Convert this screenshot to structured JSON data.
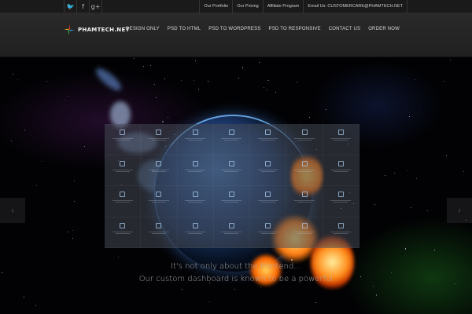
{
  "social": [
    {
      "icon": "twitter-icon",
      "glyph": "🐦"
    },
    {
      "icon": "facebook-icon",
      "glyph": "f"
    },
    {
      "icon": "google-plus-icon",
      "glyph": "g+"
    }
  ],
  "top_links": [
    "Our Portfolio",
    "Our Pricing",
    "Affiliate Program",
    "Email Us: CUSTOMERCARE@PHAMTECH.NET"
  ],
  "logo": {
    "text": "PHAMTECH.NET"
  },
  "nav": [
    "DESIGN ONLY",
    "PSD TO HTML",
    "PSD TO WORDPRESS",
    "PSD TO RESPONSIVE",
    "CONTACT US",
    "ORDER NOW"
  ],
  "dashboard": {
    "cells": [
      {
        "label": "",
        "icon": "box-icon"
      },
      {
        "label": "",
        "icon": "box-icon"
      },
      {
        "label": "",
        "icon": "box-icon"
      },
      {
        "label": "",
        "icon": "box-icon"
      },
      {
        "label": "",
        "icon": "box-icon"
      },
      {
        "label": "",
        "icon": "box-icon"
      },
      {
        "label": "",
        "icon": "box-icon"
      },
      {
        "label": "",
        "icon": "box-icon"
      },
      {
        "label": "",
        "icon": "box-icon"
      },
      {
        "label": "",
        "icon": "box-icon"
      },
      {
        "label": "",
        "icon": "box-icon"
      },
      {
        "label": "",
        "icon": "box-icon"
      },
      {
        "label": "",
        "icon": "box-icon"
      },
      {
        "label": "",
        "icon": "box-icon"
      },
      {
        "label": "",
        "icon": "box-icon"
      },
      {
        "label": "",
        "icon": "box-icon"
      },
      {
        "label": "",
        "icon": "box-icon"
      },
      {
        "label": "",
        "icon": "box-icon"
      },
      {
        "label": "",
        "icon": "box-icon"
      },
      {
        "label": "",
        "icon": "box-icon"
      },
      {
        "label": "",
        "icon": "box-icon"
      },
      {
        "label": "",
        "icon": "box-icon"
      },
      {
        "label": "",
        "icon": "box-icon"
      },
      {
        "label": "",
        "icon": "box-icon"
      },
      {
        "label": "",
        "icon": "box-icon"
      },
      {
        "label": "",
        "icon": "box-icon"
      },
      {
        "label": "",
        "icon": "box-icon"
      },
      {
        "label": "",
        "icon": "box-icon"
      }
    ]
  },
  "tagline": {
    "line1": "It's not only about the frontend...",
    "line2": "Our custom dashboard is known to be a powerful"
  },
  "slider": {
    "prev_glyph": "‹",
    "next_glyph": "›"
  },
  "colors": {
    "accent": "#ff7a1a",
    "planet": "#2b5fa8",
    "background": "#000000"
  }
}
